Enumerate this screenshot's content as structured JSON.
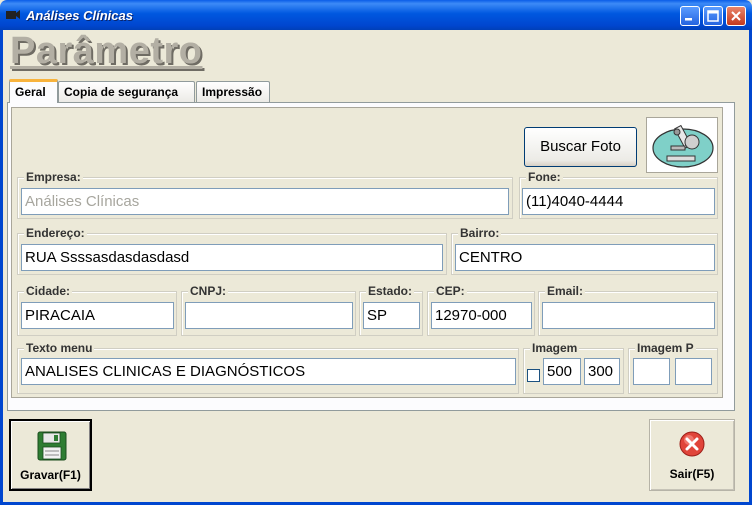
{
  "window": {
    "title": "Análises Clínicas"
  },
  "page_title": "Parâmetro",
  "tabs": [
    {
      "label": "Geral",
      "active": true
    },
    {
      "label": "Copia de segurança",
      "active": false
    },
    {
      "label": "Impressão",
      "active": false
    }
  ],
  "buttons": {
    "buscar_foto": "Buscar Foto",
    "gravar": "Gravar(F1)",
    "sair": "Sair(F5)"
  },
  "fields": {
    "empresa": {
      "label": "Empresa:",
      "value": "Análises Clínicas"
    },
    "fone": {
      "label": "Fone:",
      "value": "(11)4040-4444"
    },
    "endereco": {
      "label": "Endereço:",
      "value": "RUA Ssssasdasdasdasd"
    },
    "bairro": {
      "label": "Bairro:",
      "value": "CENTRO"
    },
    "cidade": {
      "label": "Cidade:",
      "value": "PIRACAIA"
    },
    "cnpj": {
      "label": "CNPJ:",
      "value": ""
    },
    "estado": {
      "label": "Estado:",
      "value": "SP"
    },
    "cep": {
      "label": "CEP:",
      "value": "12970-000"
    },
    "email": {
      "label": "Email:",
      "value": ""
    },
    "texto_menu": {
      "label": "Texto menu",
      "value": "ANALISES CLINICAS E DIAGNÓSTICOS"
    },
    "imagem": {
      "label": "Imagem",
      "checked": false,
      "width": "500",
      "height": "300"
    },
    "imagem_p": {
      "label": "Imagem P",
      "width": "",
      "height": ""
    }
  },
  "icons": {
    "logo": "microscope-icon",
    "save": "floppy-disk-icon",
    "exit": "red-x-icon"
  }
}
